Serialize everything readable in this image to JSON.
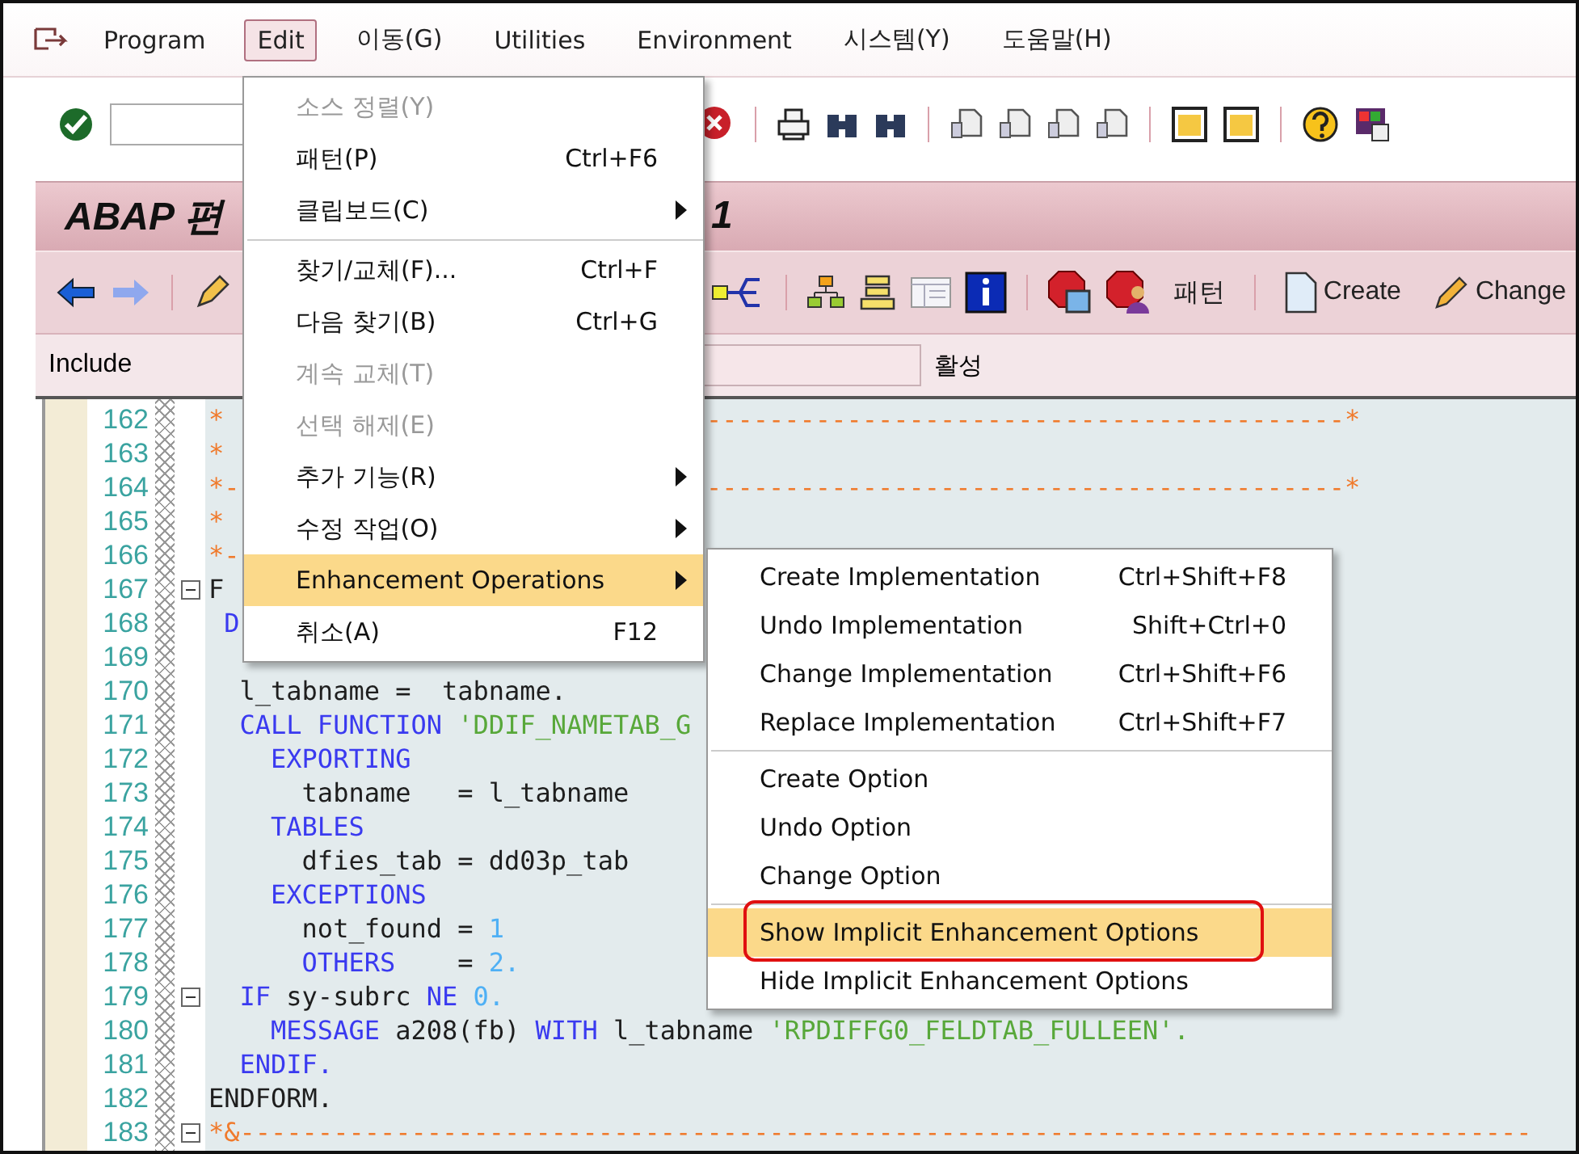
{
  "menu_bar": {
    "items": [
      {
        "label": "Program",
        "selected": false
      },
      {
        "label": "Edit",
        "selected": true
      },
      {
        "label": "이동(G)",
        "selected": false
      },
      {
        "label": "Utilities",
        "selected": false
      },
      {
        "label": "Environment",
        "selected": false
      },
      {
        "label": "시스템(Y)",
        "selected": false
      },
      {
        "label": "도움말(H)",
        "selected": false
      }
    ]
  },
  "title_bar": {
    "title_start": "ABAP 편",
    "title_end": "1"
  },
  "app_toolbar": {
    "buttons": [
      {
        "kind": "plain",
        "label": "패턴"
      },
      {
        "kind": "document",
        "label": "Create"
      },
      {
        "kind": "pencil",
        "label": "Change"
      }
    ]
  },
  "include_row": {
    "label": "Include",
    "status": "활성"
  },
  "editor": {
    "lines": [
      {
        "number": "162",
        "fold": false,
        "tokens": [
          {
            "kind": "comment",
            "text": "*"
          }
        ],
        "tail": "-----------------------------------------*"
      },
      {
        "number": "163",
        "fold": false,
        "tokens": [
          {
            "kind": "comment",
            "text": "*"
          }
        ]
      },
      {
        "number": "164",
        "fold": false,
        "tokens": [
          {
            "kind": "comment",
            "text": "*-"
          }
        ],
        "tail": "-----------------------------------------*"
      },
      {
        "number": "165",
        "fold": false,
        "tokens": [
          {
            "kind": "comment",
            "text": "*"
          }
        ]
      },
      {
        "number": "166",
        "fold": false,
        "tokens": [
          {
            "kind": "comment",
            "text": "*-"
          }
        ]
      },
      {
        "number": "167",
        "fold": true,
        "tokens": [
          {
            "kind": "plain",
            "text": "F"
          }
        ]
      },
      {
        "number": "168",
        "fold": false,
        "tokens": [
          {
            "kind": "keyword",
            "text": " D"
          }
        ]
      },
      {
        "number": "169",
        "fold": false
      },
      {
        "number": "170",
        "fold": false,
        "tokens": [
          {
            "kind": "plain",
            "text": "  l_tabname =  tabname."
          }
        ]
      },
      {
        "number": "171",
        "fold": false,
        "tokens": [
          {
            "kind": "keyword",
            "text": "  CALL FUNCTION"
          },
          {
            "kind": "string",
            "text": " 'DDIF_NAMETAB_G"
          }
        ]
      },
      {
        "number": "172",
        "fold": false,
        "tokens": [
          {
            "kind": "keyword",
            "text": "    EXPORTING"
          }
        ]
      },
      {
        "number": "173",
        "fold": false,
        "tokens": [
          {
            "kind": "plain",
            "text": "      tabname   = l_tabname"
          }
        ]
      },
      {
        "number": "174",
        "fold": false,
        "tokens": [
          {
            "kind": "keyword",
            "text": "    TABLES"
          }
        ]
      },
      {
        "number": "175",
        "fold": false,
        "tokens": [
          {
            "kind": "plain",
            "text": "      dfies_tab = dd03p_tab"
          }
        ]
      },
      {
        "number": "176",
        "fold": false,
        "tokens": [
          {
            "kind": "keyword",
            "text": "    EXCEPTIONS"
          }
        ]
      },
      {
        "number": "177",
        "fold": false,
        "tokens": [
          {
            "kind": "plain",
            "text": "      not_found = "
          },
          {
            "kind": "number",
            "text": "1"
          }
        ]
      },
      {
        "number": "178",
        "fold": false,
        "tokens": [
          {
            "kind": "keyword",
            "text": "      OTHERS"
          },
          {
            "kind": "plain",
            "text": "    = "
          },
          {
            "kind": "number",
            "text": "2."
          }
        ]
      },
      {
        "number": "179",
        "fold": true,
        "tokens": [
          {
            "kind": "keyword",
            "text": "  IF"
          },
          {
            "kind": "plain",
            "text": " sy-subrc "
          },
          {
            "kind": "keyword",
            "text": "NE"
          },
          {
            "kind": "number",
            "text": " 0."
          }
        ]
      },
      {
        "number": "180",
        "fold": false,
        "tokens": [
          {
            "kind": "keyword",
            "text": "    MESSAGE"
          },
          {
            "kind": "plain",
            "text": " a208(fb) "
          },
          {
            "kind": "keyword",
            "text": "WITH"
          },
          {
            "kind": "plain",
            "text": " l_tabname "
          },
          {
            "kind": "string",
            "text": "'RPDIFFG0_FELDTAB_FULLEEN'."
          }
        ]
      },
      {
        "number": "181",
        "fold": false,
        "tokens": [
          {
            "kind": "keyword",
            "text": "  ENDIF."
          }
        ]
      },
      {
        "number": "182",
        "fold": false,
        "tokens": [
          {
            "kind": "plain",
            "text": "ENDFORM."
          }
        ]
      },
      {
        "number": "183",
        "fold": true,
        "tokens": [
          {
            "kind": "comment",
            "text": "*&-----------------------------------------------------------------------------------"
          }
        ]
      }
    ]
  },
  "edit_menu": {
    "items": [
      {
        "kind": "item",
        "label": "소스 정렬(Y)",
        "disabled": true,
        "submenu": false,
        "selected": false
      },
      {
        "kind": "item",
        "label": "패턴(P)",
        "shortcut": "Ctrl+F6",
        "disabled": false,
        "submenu": false,
        "selected": false
      },
      {
        "kind": "item",
        "label": "클립보드(C)",
        "disabled": false,
        "submenu": true,
        "selected": false
      },
      {
        "kind": "separator"
      },
      {
        "kind": "item",
        "label": "찾기/교체(F)...",
        "shortcut": "Ctrl+F",
        "disabled": false,
        "submenu": false,
        "selected": false
      },
      {
        "kind": "item",
        "label": "다음 찾기(B)",
        "shortcut": "Ctrl+G",
        "disabled": false,
        "submenu": false,
        "selected": false
      },
      {
        "kind": "item",
        "label": "계속 교체(T)",
        "disabled": true,
        "submenu": false,
        "selected": false
      },
      {
        "kind": "item",
        "label": "선택 해제(E)",
        "disabled": true,
        "submenu": false,
        "selected": false
      },
      {
        "kind": "item",
        "label": "추가 기능(R)",
        "disabled": false,
        "submenu": true,
        "selected": false
      },
      {
        "kind": "item",
        "label": "수정 작업(O)",
        "disabled": false,
        "submenu": true,
        "selected": false
      },
      {
        "kind": "item",
        "label": "Enhancement Operations",
        "disabled": false,
        "submenu": true,
        "selected": true
      },
      {
        "kind": "item",
        "label": "취소(A)",
        "shortcut": "F12",
        "disabled": false,
        "submenu": false,
        "selected": false
      }
    ]
  },
  "submenu": {
    "items": [
      {
        "kind": "item",
        "label": "Create Implementation",
        "shortcut": "Ctrl+Shift+F8",
        "selected": false,
        "callout": false
      },
      {
        "kind": "item",
        "label": "Undo Implementation",
        "shortcut": "Shift+Ctrl+0",
        "selected": false,
        "callout": false
      },
      {
        "kind": "item",
        "label": "Change Implementation",
        "shortcut": "Ctrl+Shift+F6",
        "selected": false,
        "callout": false
      },
      {
        "kind": "item",
        "label": "Replace Implementation",
        "shortcut": "Ctrl+Shift+F7",
        "selected": false,
        "callout": false
      },
      {
        "kind": "separator"
      },
      {
        "kind": "item",
        "label": "Create Option",
        "selected": false,
        "callout": false
      },
      {
        "kind": "item",
        "label": "Undo Option",
        "selected": false,
        "callout": false
      },
      {
        "kind": "item",
        "label": "Change Option",
        "selected": false,
        "callout": false
      },
      {
        "kind": "separator"
      },
      {
        "kind": "item",
        "label": "Show Implicit Enhancement Options",
        "selected": true,
        "callout": true
      },
      {
        "kind": "item",
        "label": "Hide Implicit Enhancement Options",
        "selected": false,
        "callout": false
      }
    ]
  }
}
